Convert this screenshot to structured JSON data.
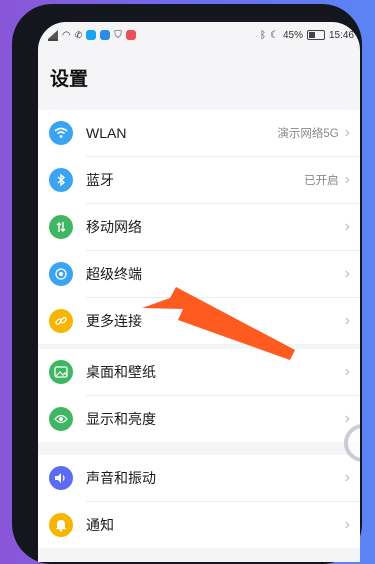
{
  "status_bar": {
    "battery_percent": "45%",
    "time": "15:46"
  },
  "page_title": "设置",
  "groups": [
    {
      "items": [
        {
          "label": "WLAN",
          "value": "演示网络5G",
          "icon": "wifi-icon",
          "color": "#3aa3f2"
        },
        {
          "label": "蓝牙",
          "value": "已开启",
          "icon": "bluetooth-icon",
          "color": "#3aa3f2"
        },
        {
          "label": "移动网络",
          "value": "",
          "icon": "mobile-network-icon",
          "color": "#3fb662"
        },
        {
          "label": "超级终端",
          "value": "",
          "icon": "super-device-icon",
          "color": "#3aa3f2"
        },
        {
          "label": "更多连接",
          "value": "",
          "icon": "link-icon",
          "color": "#f7b500"
        }
      ]
    },
    {
      "items": [
        {
          "label": "桌面和壁纸",
          "value": "",
          "icon": "wallpaper-icon",
          "color": "#3fb662"
        },
        {
          "label": "显示和亮度",
          "value": "",
          "icon": "eye-icon",
          "color": "#3fb662"
        }
      ]
    },
    {
      "items": [
        {
          "label": "声音和振动",
          "value": "",
          "icon": "sound-icon",
          "color": "#5b6cf2"
        },
        {
          "label": "通知",
          "value": "",
          "icon": "bell-icon",
          "color": "#f7b500"
        }
      ]
    }
  ],
  "annotation_color": "#ff5a1f"
}
